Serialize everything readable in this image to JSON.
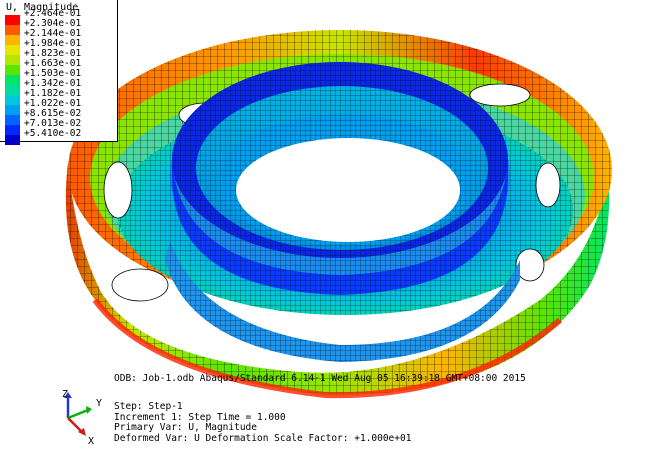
{
  "legend": {
    "title": "U, Magnitude",
    "ticks": [
      "+2.464e-01",
      "+2.304e-01",
      "+2.144e-01",
      "+1.984e-01",
      "+1.823e-01",
      "+1.663e-01",
      "+1.503e-01",
      "+1.342e-01",
      "+1.182e-01",
      "+1.022e-01",
      "+8.615e-02",
      "+7.013e-02",
      "+5.410e-02"
    ],
    "colors": [
      "#ff0000",
      "#ff5a00",
      "#ffb400",
      "#e6e600",
      "#b4e600",
      "#5ae600",
      "#00e664",
      "#00dca0",
      "#00c8dc",
      "#00a0f0",
      "#0064ff",
      "#0028ff",
      "#0000c8"
    ]
  },
  "info": {
    "odb_line": "ODB: Job-1.odb    Abaqus/Standard 6.14-1    Wed Aug 05 16:39:18 GMT+08:00 2015",
    "step": "Step: Step-1",
    "increment": "Increment    1: Step Time =    1.000",
    "primary_var": "Primary Var: U, Magnitude",
    "deformed_var": "Deformed Var: U   Deformation Scale Factor: +1.000e+01"
  },
  "triad": {
    "z_label": "Z",
    "y_label": "Y",
    "x_label": "X"
  },
  "model": {
    "description_colors": {
      "outer": "#ff3a00",
      "mid": "#d7e600",
      "inner": "#00b4e6",
      "core": "#0020e0"
    }
  }
}
